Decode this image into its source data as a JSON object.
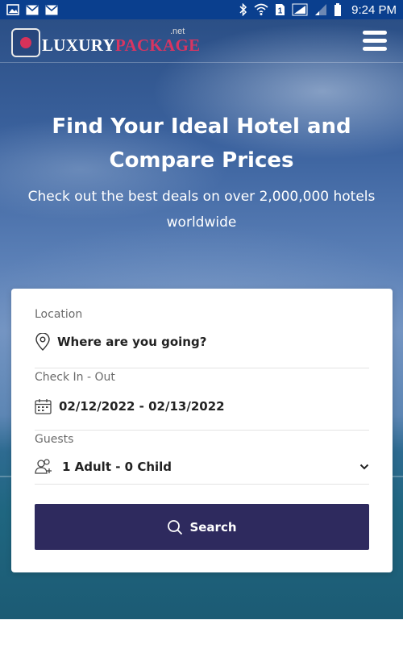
{
  "status_bar": {
    "left_icons": [
      "image-icon",
      "mail-icon",
      "mail-icon"
    ],
    "right_icons": [
      "bluetooth-icon",
      "wifi-icon",
      "sim-icon",
      "signal-icon",
      "signal-weak-icon",
      "battery-icon"
    ],
    "sim_number": "1",
    "time": "9:24 PM"
  },
  "navbar": {
    "logo_part1": "LUXURY",
    "logo_part2": "PACKAGE",
    "logo_suffix": ".net",
    "menu_icon": "hamburger-menu-icon"
  },
  "hero": {
    "headline": "Find Your Ideal Hotel and Compare Prices",
    "subline": "Check out the best deals on over 2,000,000 hotels worldwide"
  },
  "search_form": {
    "location": {
      "label": "Location",
      "placeholder": "Where are you going?",
      "icon": "map-pin-icon"
    },
    "dates": {
      "label": "Check In - Out",
      "value": "02/12/2022 - 02/13/2022",
      "icon": "calendar-icon"
    },
    "guests": {
      "label": "Guests",
      "value": "1 Adult - 0 Child",
      "icon": "add-user-icon",
      "dropdown_icon": "chevron-down-icon"
    },
    "search_button": {
      "label": "Search",
      "icon": "search-icon"
    }
  },
  "colors": {
    "status_bar": "#0a3f8e",
    "brand_pink": "#d73562",
    "button_bg": "#2e2a5e",
    "card_bg": "#ffffff"
  }
}
